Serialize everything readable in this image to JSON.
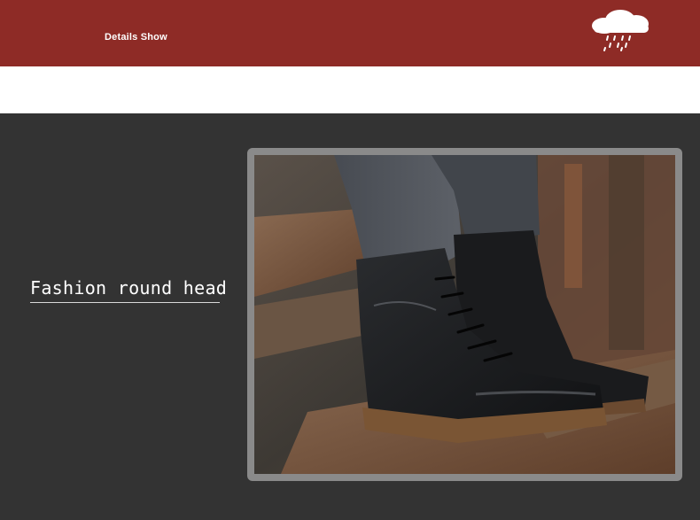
{
  "banner": {
    "title": "Details Show",
    "background_color": "#8e2b26",
    "icon": "rain-cloud-icon"
  },
  "feature": {
    "label": "Fashion round head",
    "background_color": "#333333",
    "photo_subject": "black lace-up rain boots on rusty stairs"
  }
}
